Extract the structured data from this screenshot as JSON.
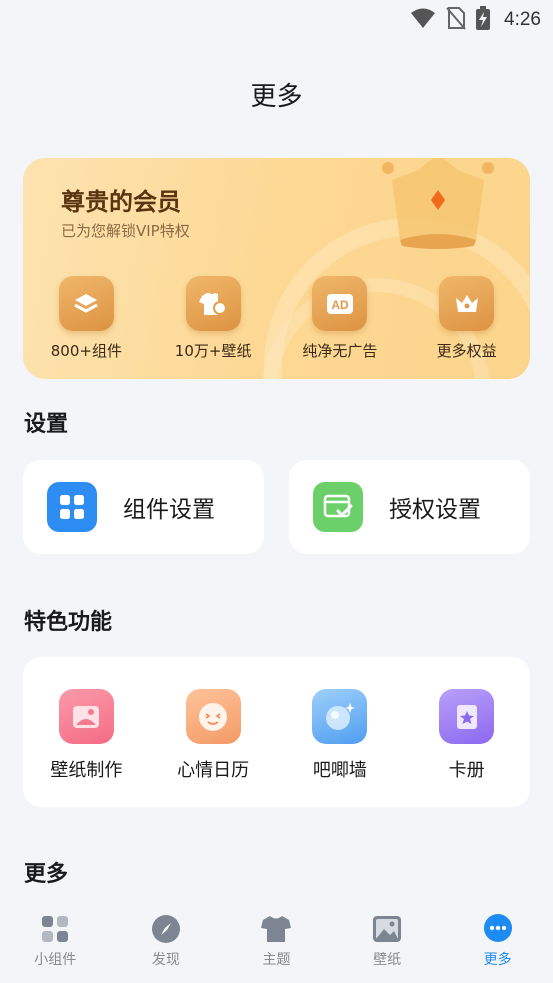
{
  "status": {
    "time": "4:26"
  },
  "page": {
    "title": "更多"
  },
  "vip": {
    "title": "尊贵的会员",
    "subtitle": "已为您解锁VIP特权",
    "perks": [
      {
        "label": "800+组件",
        "icon": "layers-icon"
      },
      {
        "label": "10万+壁纸",
        "icon": "shirt-icon"
      },
      {
        "label": "纯净无广告",
        "icon": "ad-icon"
      },
      {
        "label": "更多权益",
        "icon": "crown-icon"
      }
    ]
  },
  "settings": {
    "title": "设置",
    "items": [
      {
        "label": "组件设置",
        "icon": "grid-icon",
        "color": "#2e8df3"
      },
      {
        "label": "授权设置",
        "icon": "window-check-icon",
        "color": "#6cd06a"
      }
    ]
  },
  "features": {
    "title": "特色功能",
    "items": [
      {
        "label": "壁纸制作",
        "icon": "image-icon",
        "color": "#f6798f"
      },
      {
        "label": "心情日历",
        "icon": "smile-face-icon",
        "color": "#f7a472"
      },
      {
        "label": "吧唧墙",
        "icon": "badge-icon",
        "color": "#5aa8f3"
      },
      {
        "label": "卡册",
        "icon": "star-album-icon",
        "color": "#9b7cf1"
      }
    ]
  },
  "more_section": {
    "title": "更多"
  },
  "nav": {
    "items": [
      {
        "label": "小组件",
        "icon": "widgets-icon",
        "active": false
      },
      {
        "label": "发现",
        "icon": "compass-icon",
        "active": false
      },
      {
        "label": "主题",
        "icon": "tshirt-icon",
        "active": false
      },
      {
        "label": "壁纸",
        "icon": "picture-icon",
        "active": false
      },
      {
        "label": "更多",
        "icon": "more-chat-icon",
        "active": true
      }
    ],
    "active_color": "#1c8bf2"
  }
}
